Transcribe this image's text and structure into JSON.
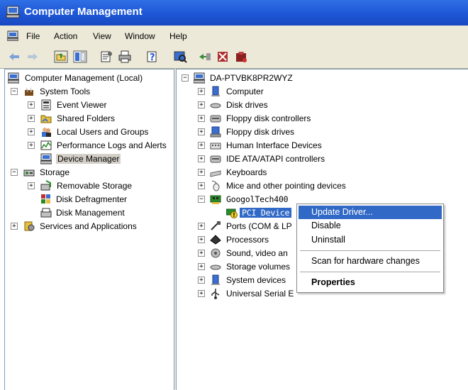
{
  "window": {
    "title": "Computer Management"
  },
  "menu": [
    "File",
    "Action",
    "View",
    "Window",
    "Help"
  ],
  "toolbar": [
    "back-arrow-icon",
    "forward-arrow-icon",
    "up-folder-icon",
    "show-hide-tree-icon",
    "properties-icon",
    "print-icon",
    "help-icon",
    "scan-hardware-icon",
    "update-driver-icon",
    "disable-device-icon",
    "uninstall-device-icon"
  ],
  "tree": {
    "root": "Computer Management (Local)",
    "system_tools": "System Tools",
    "event_viewer": "Event Viewer",
    "shared_folders": "Shared Folders",
    "local_users": "Local Users and Groups",
    "perf_logs": "Performance Logs and Alerts",
    "device_manager": "Device Manager",
    "storage": "Storage",
    "removable_storage": "Removable Storage",
    "disk_defrag": "Disk Defragmenter",
    "disk_mgmt": "Disk Management",
    "services_apps": "Services and Applications"
  },
  "devices": {
    "root": "DA-PTVBK8PR2WYZ",
    "items": [
      "Computer",
      "Disk drives",
      "Floppy disk controllers",
      "Floppy disk drives",
      "Human Interface Devices",
      "IDE ATA/ATAPI controllers",
      "Keyboards",
      "Mice and other pointing devices",
      "GoogolTech400",
      "PCI Device",
      "Ports (COM & LP",
      "Processors",
      "Sound, video an",
      "Storage volumes",
      "System devices",
      "Universal Serial E"
    ]
  },
  "context_menu": {
    "update_driver": "Update Driver...",
    "disable": "Disable",
    "uninstall": "Uninstall",
    "scan": "Scan for hardware changes",
    "properties": "Properties"
  },
  "colors": {
    "titlebar": "#1d56d6",
    "selection": "#3169c6",
    "chrome": "#ece9d8"
  }
}
